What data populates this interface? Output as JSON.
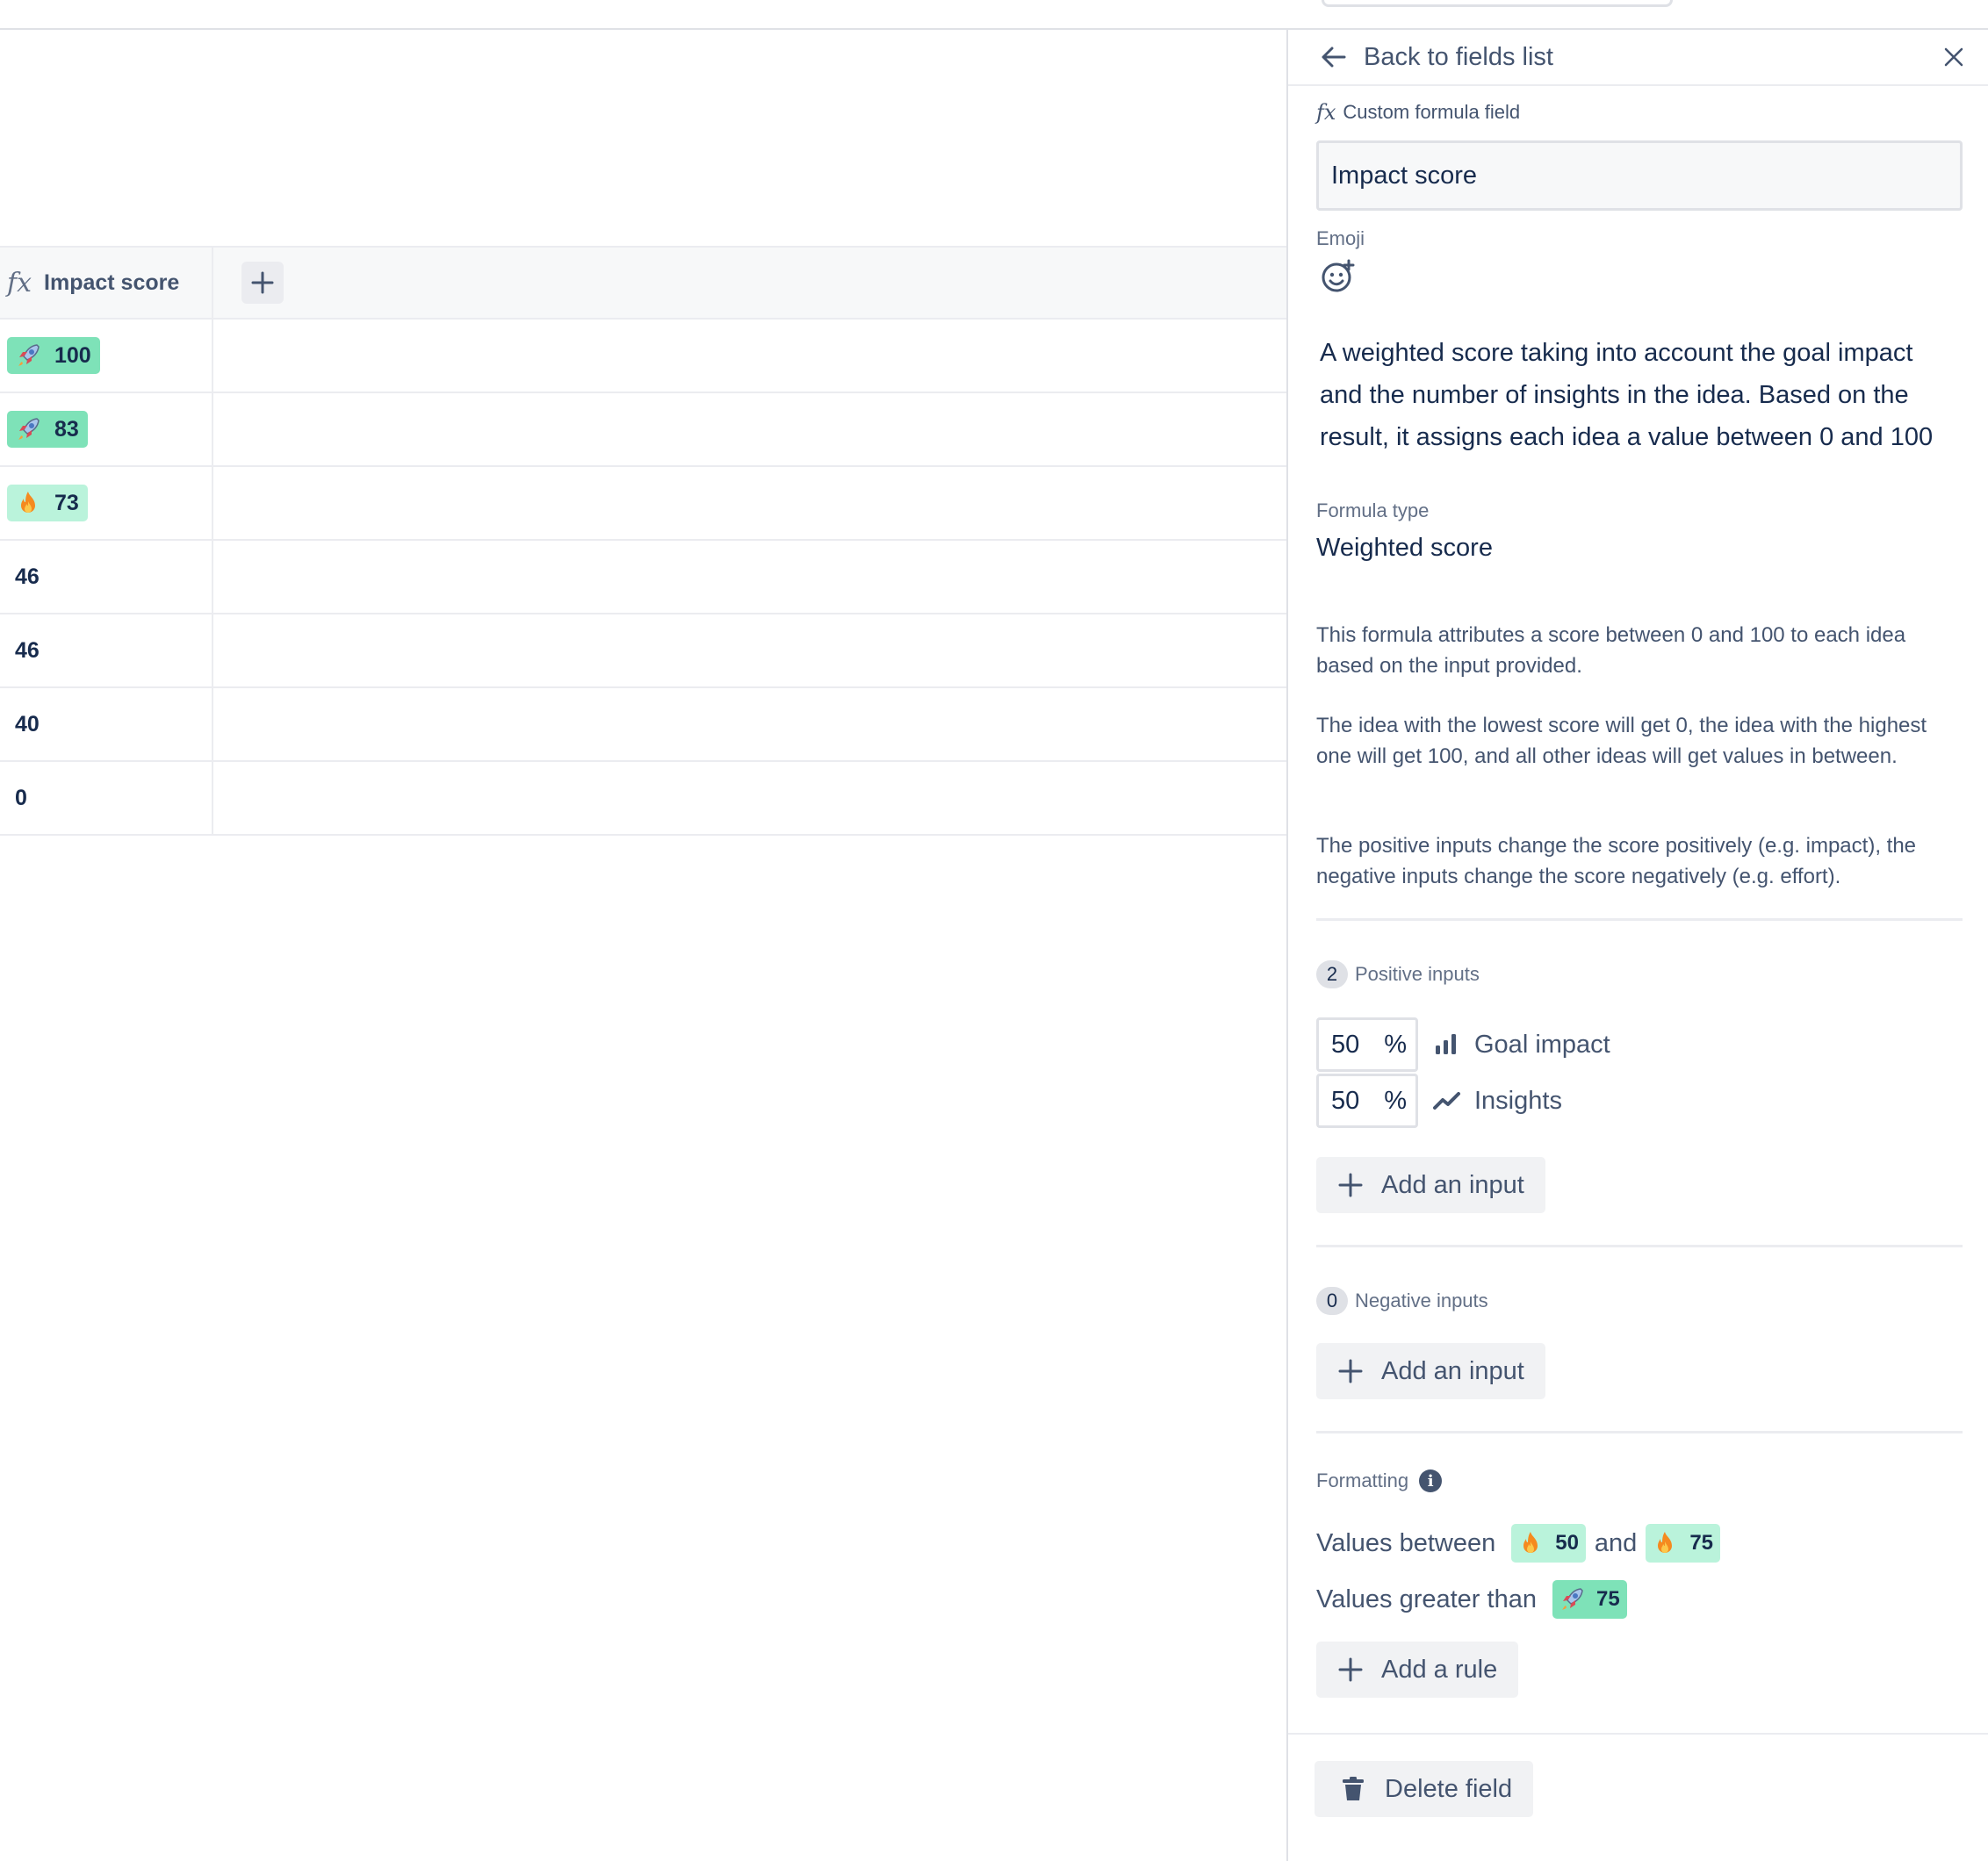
{
  "table": {
    "column_icon": "fx",
    "column_title": "Impact score",
    "add_column_icon": "plus-icon",
    "rows": [
      {
        "value": "100",
        "badge": "green",
        "icon": "rocket-icon"
      },
      {
        "value": "83",
        "badge": "green",
        "icon": "rocket-icon"
      },
      {
        "value": "73",
        "badge": "light",
        "icon": "fire-icon"
      },
      {
        "value": "46"
      },
      {
        "value": "46"
      },
      {
        "value": "40"
      },
      {
        "value": "0"
      }
    ]
  },
  "panel": {
    "back_label": "Back to fields list",
    "field_kind_icon": "fx",
    "field_kind": "Custom formula field",
    "name_value": "Impact score",
    "emoji_label": "Emoji",
    "description": "A weighted score taking into account the goal impact and the number of insights in the idea. Based on the result, it assigns each idea a value between 0 and 100",
    "formula_type_label": "Formula type",
    "formula_type_value": "Weighted score",
    "help_1": "This formula attributes a score between 0 and 100 to each idea based on the input provided.",
    "help_2": "The idea with the lowest score will get 0, the idea with the highest one will get 100, and all other ideas will get values in between.",
    "help_3": "The positive inputs change the score positively (e.g. impact), the negative inputs change the score negatively (e.g. effort).",
    "positive": {
      "count": "2",
      "label": "Positive inputs",
      "inputs": [
        {
          "weight": "50",
          "unit": "%",
          "icon": "bar-chart-icon",
          "label": "Goal impact"
        },
        {
          "weight": "50",
          "unit": "%",
          "icon": "trend-line-icon",
          "label": "Insights"
        }
      ],
      "add_label": "Add an input"
    },
    "negative": {
      "count": "0",
      "label": "Negative inputs",
      "add_label": "Add an input"
    },
    "formatting": {
      "label": "Formatting",
      "info_icon": "i",
      "rule1": {
        "prefix": "Values between",
        "from": "50",
        "joiner": "and",
        "to": "75"
      },
      "rule2": {
        "prefix": "Values greater than",
        "value": "75"
      },
      "add_label": "Add a rule"
    },
    "delete_label": "Delete field"
  },
  "colors": {
    "badge_green": "#7ee2b8",
    "badge_light": "#baf3db",
    "text_primary": "#172b4d",
    "text_subtle": "#44546f",
    "border": "#dfe1e6"
  }
}
